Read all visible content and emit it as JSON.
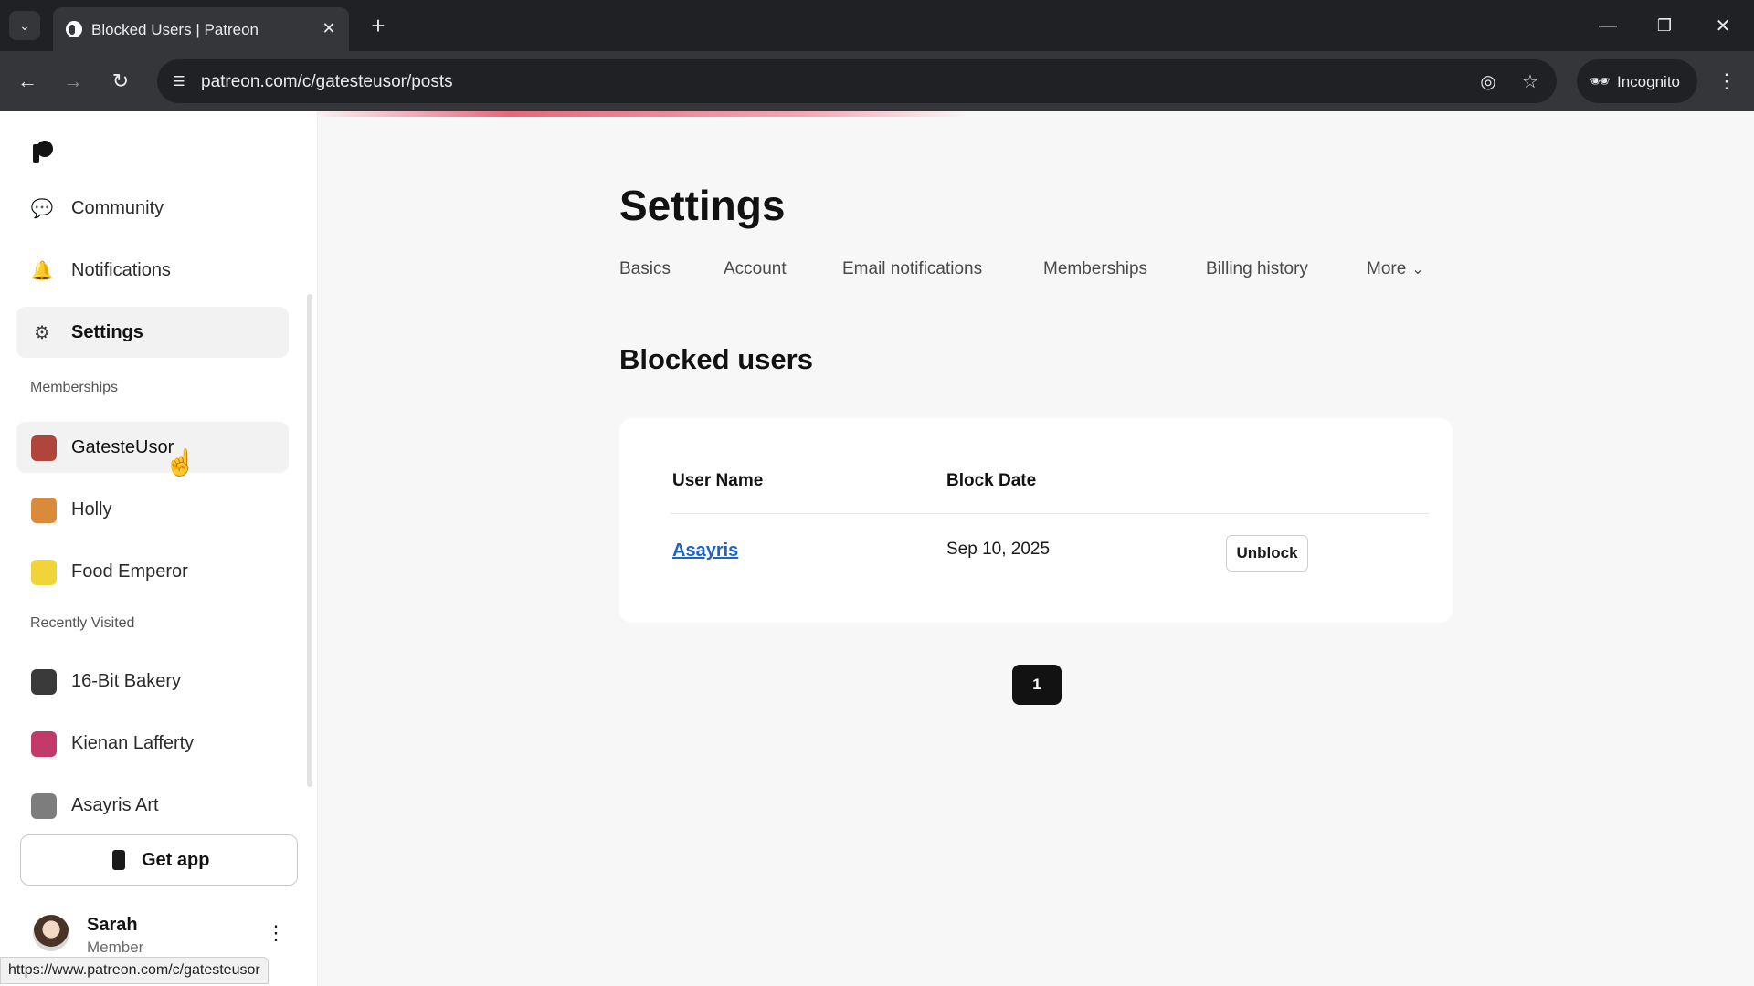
{
  "browser": {
    "tab_title": "Blocked Users | Patreon",
    "url": "patreon.com/c/gatesteusor/posts",
    "incognito_label": "Incognito",
    "status_url": "https://www.patreon.com/c/gatesteusor"
  },
  "sidebar": {
    "nav": [
      {
        "label": "Community",
        "icon": "community-icon"
      },
      {
        "label": "Notifications",
        "icon": "bell-icon"
      },
      {
        "label": "Settings",
        "icon": "gear-icon",
        "active": true
      }
    ],
    "memberships_heading": "Memberships",
    "memberships": [
      {
        "label": "GatesteUsor",
        "color": "#b0453c"
      },
      {
        "label": "Holly",
        "color": "#d98a3a"
      },
      {
        "label": "Food Emperor",
        "color": "#f1d43a"
      }
    ],
    "recent_heading": "Recently Visited",
    "recent": [
      {
        "label": "16-Bit Bakery",
        "color": "#3a3a3a"
      },
      {
        "label": "Kienan Lafferty",
        "color": "#c23a6a"
      },
      {
        "label": "Asayris Art",
        "color": "#7d7d7d"
      }
    ],
    "get_app_label": "Get app",
    "user": {
      "name": "Sarah",
      "role": "Member"
    }
  },
  "main": {
    "title": "Settings",
    "tabs": [
      "Basics",
      "Account",
      "Email notifications",
      "Memberships",
      "Billing history",
      "More"
    ],
    "section_title": "Blocked users",
    "table": {
      "headers": [
        "User Name",
        "Block Date"
      ],
      "rows": [
        {
          "user": "Asayris",
          "date": "Sep 10, 2025",
          "action": "Unblock"
        }
      ]
    },
    "pagination": {
      "current": "1"
    }
  }
}
